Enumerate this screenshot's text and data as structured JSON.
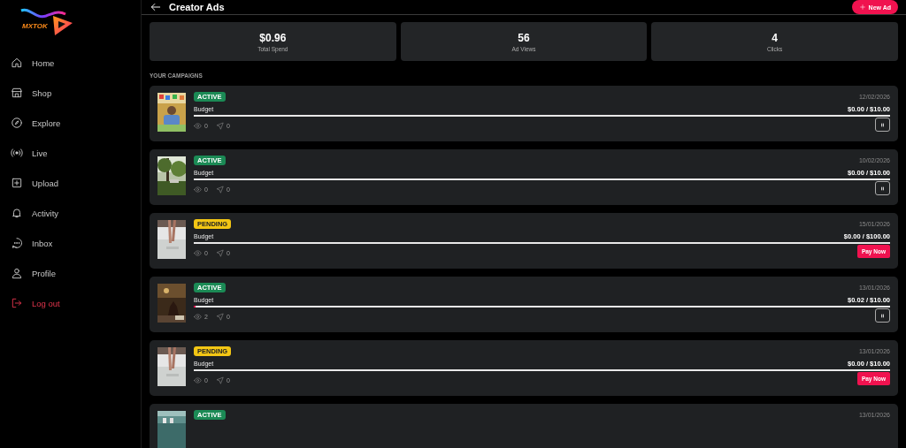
{
  "sidebar": {
    "logo": "MXTOK",
    "items": [
      {
        "label": "Home",
        "kind": "nav"
      },
      {
        "label": "Shop",
        "kind": "nav"
      },
      {
        "label": "Explore",
        "kind": "nav"
      },
      {
        "label": "Live",
        "kind": "nav"
      },
      {
        "label": "Upload",
        "kind": "nav"
      },
      {
        "label": "Activity",
        "kind": "nav"
      },
      {
        "label": "Inbox",
        "kind": "nav"
      },
      {
        "label": "Profile",
        "kind": "nav"
      },
      {
        "label": "Log out",
        "kind": "logout"
      }
    ]
  },
  "header": {
    "title": "Creator Ads",
    "new_button": "New Ad"
  },
  "stats": [
    {
      "value": "$0.96",
      "label": "Total Spend"
    },
    {
      "value": "56",
      "label": "Ad Views"
    },
    {
      "value": "4",
      "label": "Clicks"
    }
  ],
  "section_title": "YOUR CAMPAIGNS",
  "campaigns": [
    {
      "status": "ACTIVE",
      "kind": "active",
      "date": "12/02/2026",
      "budget_label": "Budget",
      "budget": "$0.00 / $10.00",
      "level": 0,
      "views": "0",
      "clicks": "0",
      "button": {
        "kind": "pause"
      }
    },
    {
      "status": "ACTIVE",
      "kind": "active",
      "date": "10/02/2026",
      "budget_label": "Budget",
      "budget": "$0.00 / $10.00",
      "level": 0,
      "views": "0",
      "clicks": "0",
      "button": {
        "kind": "pause"
      }
    },
    {
      "status": "PENDING",
      "kind": "pending",
      "date": "15/01/2026",
      "budget_label": "Budget",
      "budget": "$0.00 / $100.00",
      "level": 0,
      "views": "0",
      "clicks": "0",
      "button": {
        "kind": "pay",
        "label": "Pay Now"
      }
    },
    {
      "status": "ACTIVE",
      "kind": "active",
      "date": "13/01/2026",
      "budget_label": "Budget",
      "budget": "$0.02 / $10.00",
      "level": 0.002,
      "views": "2",
      "clicks": "0",
      "button": {
        "kind": "pause"
      }
    },
    {
      "status": "PENDING",
      "kind": "pending",
      "date": "13/01/2026",
      "budget_label": "Budget",
      "budget": "$0.00 / $10.00",
      "level": 0,
      "views": "0",
      "clicks": "0",
      "button": {
        "kind": "pay",
        "label": "Pay Now"
      }
    },
    {
      "status": "ACTIVE",
      "kind": "active",
      "date": "13/01/2026"
    }
  ]
}
